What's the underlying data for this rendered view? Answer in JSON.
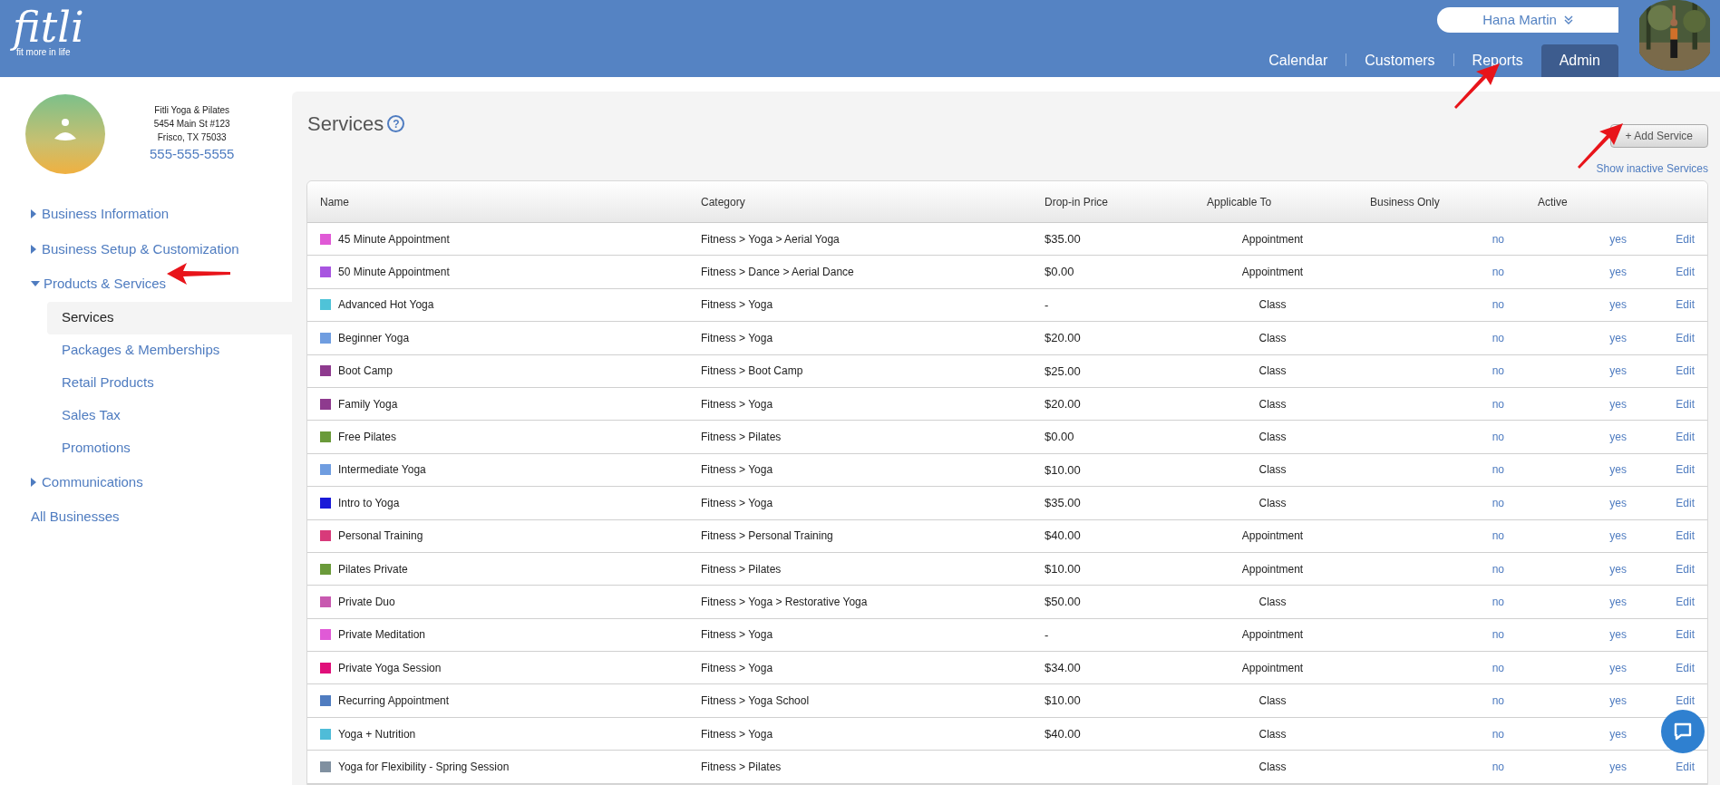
{
  "brand": {
    "logo": "fitli",
    "tagline": "fit more in life"
  },
  "nav": [
    {
      "label": "Calendar",
      "selected": false
    },
    {
      "label": "Customers",
      "selected": false
    },
    {
      "label": "Reports",
      "selected": false
    },
    {
      "label": "Admin",
      "selected": true
    }
  ],
  "user": {
    "name": "Hana Martin"
  },
  "business": {
    "name": "Fitli Yoga & Pilates",
    "address": "5454 Main St #123",
    "city": "Frisco, TX 75033",
    "phone": "555-555-5555"
  },
  "sidebar": {
    "items": [
      {
        "label": "Business Information",
        "expanded": false
      },
      {
        "label": "Business Setup & Customization",
        "expanded": false
      },
      {
        "label": "Products & Services",
        "expanded": true,
        "children": [
          {
            "label": "Services",
            "selected": true
          },
          {
            "label": "Packages & Memberships",
            "selected": false
          },
          {
            "label": "Retail Products",
            "selected": false
          },
          {
            "label": "Sales Tax",
            "selected": false
          },
          {
            "label": "Promotions",
            "selected": false
          }
        ]
      },
      {
        "label": "Communications",
        "expanded": false
      }
    ],
    "footer_link": "All Businesses"
  },
  "page": {
    "title": "Services",
    "help": "?",
    "add_button": "+ Add Service",
    "inactive_link": "Show inactive Services"
  },
  "table": {
    "columns": [
      "Name",
      "Category",
      "Drop-in Price",
      "Applicable To",
      "Business Only",
      "Active"
    ],
    "rows": [
      {
        "name": "45 Minute Appointment",
        "color": "#e05ad6",
        "category": "Fitness > Yoga > Aerial Yoga",
        "price": "$35.00",
        "applicable": "Appointment",
        "business_only": "no",
        "active": "yes",
        "action": "Edit"
      },
      {
        "name": "50 Minute Appointment",
        "color": "#a855e0",
        "category": "Fitness > Dance > Aerial Dance",
        "price": "$0.00",
        "applicable": "Appointment",
        "business_only": "no",
        "active": "yes",
        "action": "Edit"
      },
      {
        "name": "Advanced Hot Yoga",
        "color": "#4fc3d8",
        "category": "Fitness > Yoga",
        "price": "-",
        "applicable": "Class",
        "business_only": "no",
        "active": "yes",
        "action": "Edit"
      },
      {
        "name": "Beginner Yoga",
        "color": "#6f9de0",
        "category": "Fitness > Yoga",
        "price": "$20.00",
        "applicable": "Class",
        "business_only": "no",
        "active": "yes",
        "action": "Edit"
      },
      {
        "name": "Boot Camp",
        "color": "#8e3a8e",
        "category": "Fitness > Boot Camp",
        "price": "$25.00",
        "applicable": "Class",
        "business_only": "no",
        "active": "yes",
        "action": "Edit"
      },
      {
        "name": "Family Yoga",
        "color": "#8e3a8e",
        "category": "Fitness > Yoga",
        "price": "$20.00",
        "applicable": "Class",
        "business_only": "no",
        "active": "yes",
        "action": "Edit"
      },
      {
        "name": "Free Pilates",
        "color": "#6a9a3a",
        "category": "Fitness > Pilates",
        "price": "$0.00",
        "applicable": "Class",
        "business_only": "no",
        "active": "yes",
        "action": "Edit"
      },
      {
        "name": "Intermediate Yoga",
        "color": "#6f9de0",
        "category": "Fitness > Yoga",
        "price": "$10.00",
        "applicable": "Class",
        "business_only": "no",
        "active": "yes",
        "action": "Edit"
      },
      {
        "name": "Intro to Yoga",
        "color": "#1a1ad8",
        "category": "Fitness > Yoga",
        "price": "$35.00",
        "applicable": "Class",
        "business_only": "no",
        "active": "yes",
        "action": "Edit"
      },
      {
        "name": "Personal Training",
        "color": "#d83a7a",
        "category": "Fitness > Personal Training",
        "price": "$40.00",
        "applicable": "Appointment",
        "business_only": "no",
        "active": "yes",
        "action": "Edit"
      },
      {
        "name": "Pilates Private",
        "color": "#6a9a3a",
        "category": "Fitness > Pilates",
        "price": "$10.00",
        "applicable": "Appointment",
        "business_only": "no",
        "active": "yes",
        "action": "Edit"
      },
      {
        "name": "Private Duo",
        "color": "#c85ab0",
        "category": "Fitness > Yoga > Restorative Yoga",
        "price": "$50.00",
        "applicable": "Class",
        "business_only": "no",
        "active": "yes",
        "action": "Edit"
      },
      {
        "name": "Private Meditation",
        "color": "#e05ad6",
        "category": "Fitness > Yoga",
        "price": "-",
        "applicable": "Appointment",
        "business_only": "no",
        "active": "yes",
        "action": "Edit"
      },
      {
        "name": "Private Yoga Session",
        "color": "#e0107a",
        "category": "Fitness > Yoga",
        "price": "$34.00",
        "applicable": "Appointment",
        "business_only": "no",
        "active": "yes",
        "action": "Edit"
      },
      {
        "name": "Recurring Appointment",
        "color": "#4f7cc0",
        "category": "Fitness > Yoga School",
        "price": "$10.00",
        "applicable": "Class",
        "business_only": "no",
        "active": "yes",
        "action": "Edit"
      },
      {
        "name": "Yoga + Nutrition",
        "color": "#4fbcd8",
        "category": "Fitness > Yoga",
        "price": "$40.00",
        "applicable": "Class",
        "business_only": "no",
        "active": "yes"
      },
      {
        "name": "Yoga for Flexibility - Spring Session",
        "color": "#8090a0",
        "category": "Fitness > Pilates",
        "applicable": "Class",
        "business_only": "no",
        "active": "yes",
        "action": "Edit"
      }
    ]
  }
}
